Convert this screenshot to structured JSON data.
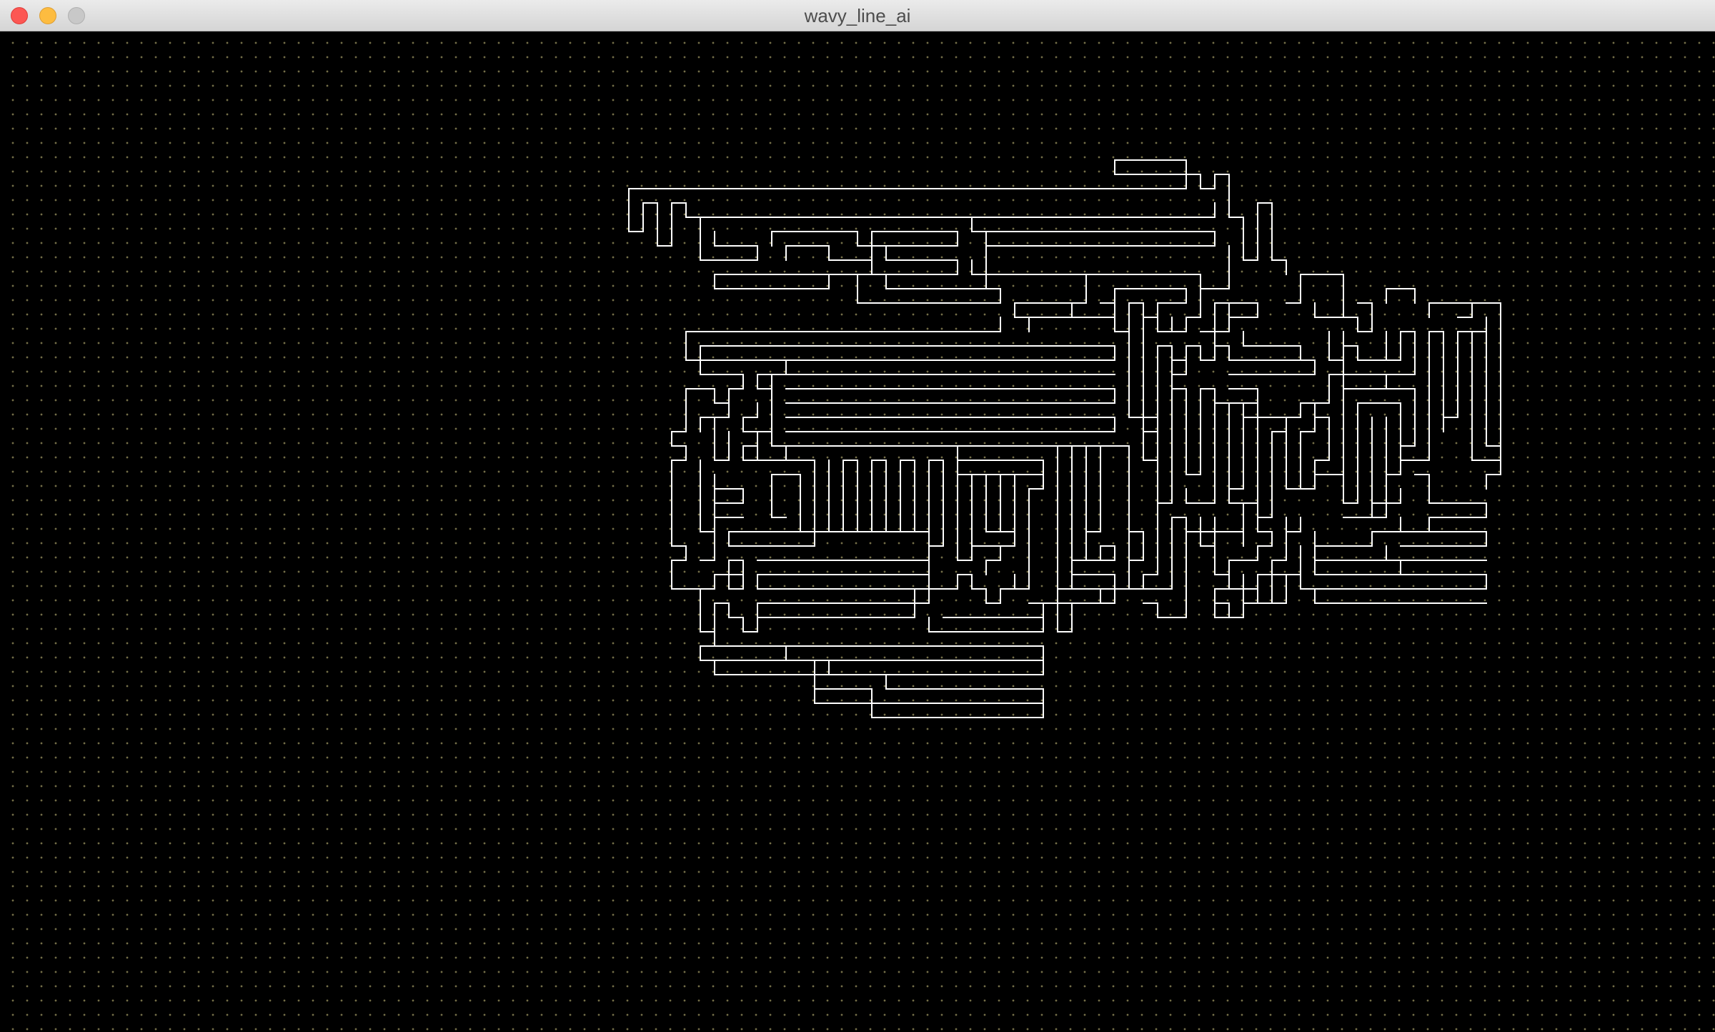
{
  "window": {
    "title": "wavy_line_ai"
  },
  "colors": {
    "canvas_background": "#000000",
    "line": "#ffffff",
    "grid_dot": "#d2c882"
  }
}
